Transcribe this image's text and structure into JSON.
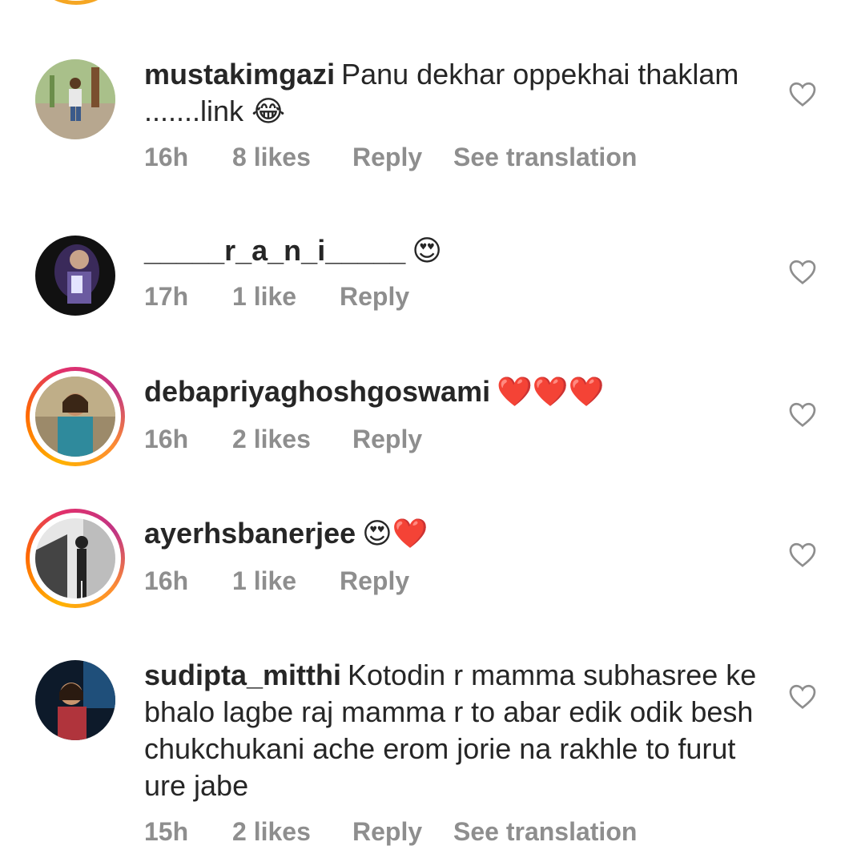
{
  "comments": [
    {
      "username": "mustakimgazi",
      "text": "Panu dekhar oppekhai thaklam .......link",
      "emoji": "😂",
      "time": "16h",
      "likes": "8 likes",
      "reply": "Reply",
      "translation": "See translation"
    },
    {
      "username": "_____r_a_n_i_____",
      "text": "",
      "emoji": "😍",
      "time": "17h",
      "likes": "1 like",
      "reply": "Reply"
    },
    {
      "username": "debapriyaghoshgoswami",
      "text": "",
      "emoji": "❤️❤️❤️",
      "time": "16h",
      "likes": "2 likes",
      "reply": "Reply"
    },
    {
      "username": "ayerhsbanerjee",
      "text": "",
      "emoji": "😍❤️",
      "time": "16h",
      "likes": "1 like",
      "reply": "Reply"
    },
    {
      "username": "sudipta_mitthi",
      "text": "Kotodin r mamma subhasree ke bhalo lagbe raj mamma r to abar edik odik besh chukchukani ache erom jorie na rakhle to furut ure jabe",
      "emoji": "",
      "time": "15h",
      "likes": "2 likes",
      "reply": "Reply",
      "translation": "See translation"
    }
  ],
  "icons": {
    "like": "heart-outline-icon"
  },
  "colors": {
    "text": "#262626",
    "meta": "#8e8e8e",
    "story_ring_start": "#ffb300",
    "story_ring_end": "#c13584"
  }
}
